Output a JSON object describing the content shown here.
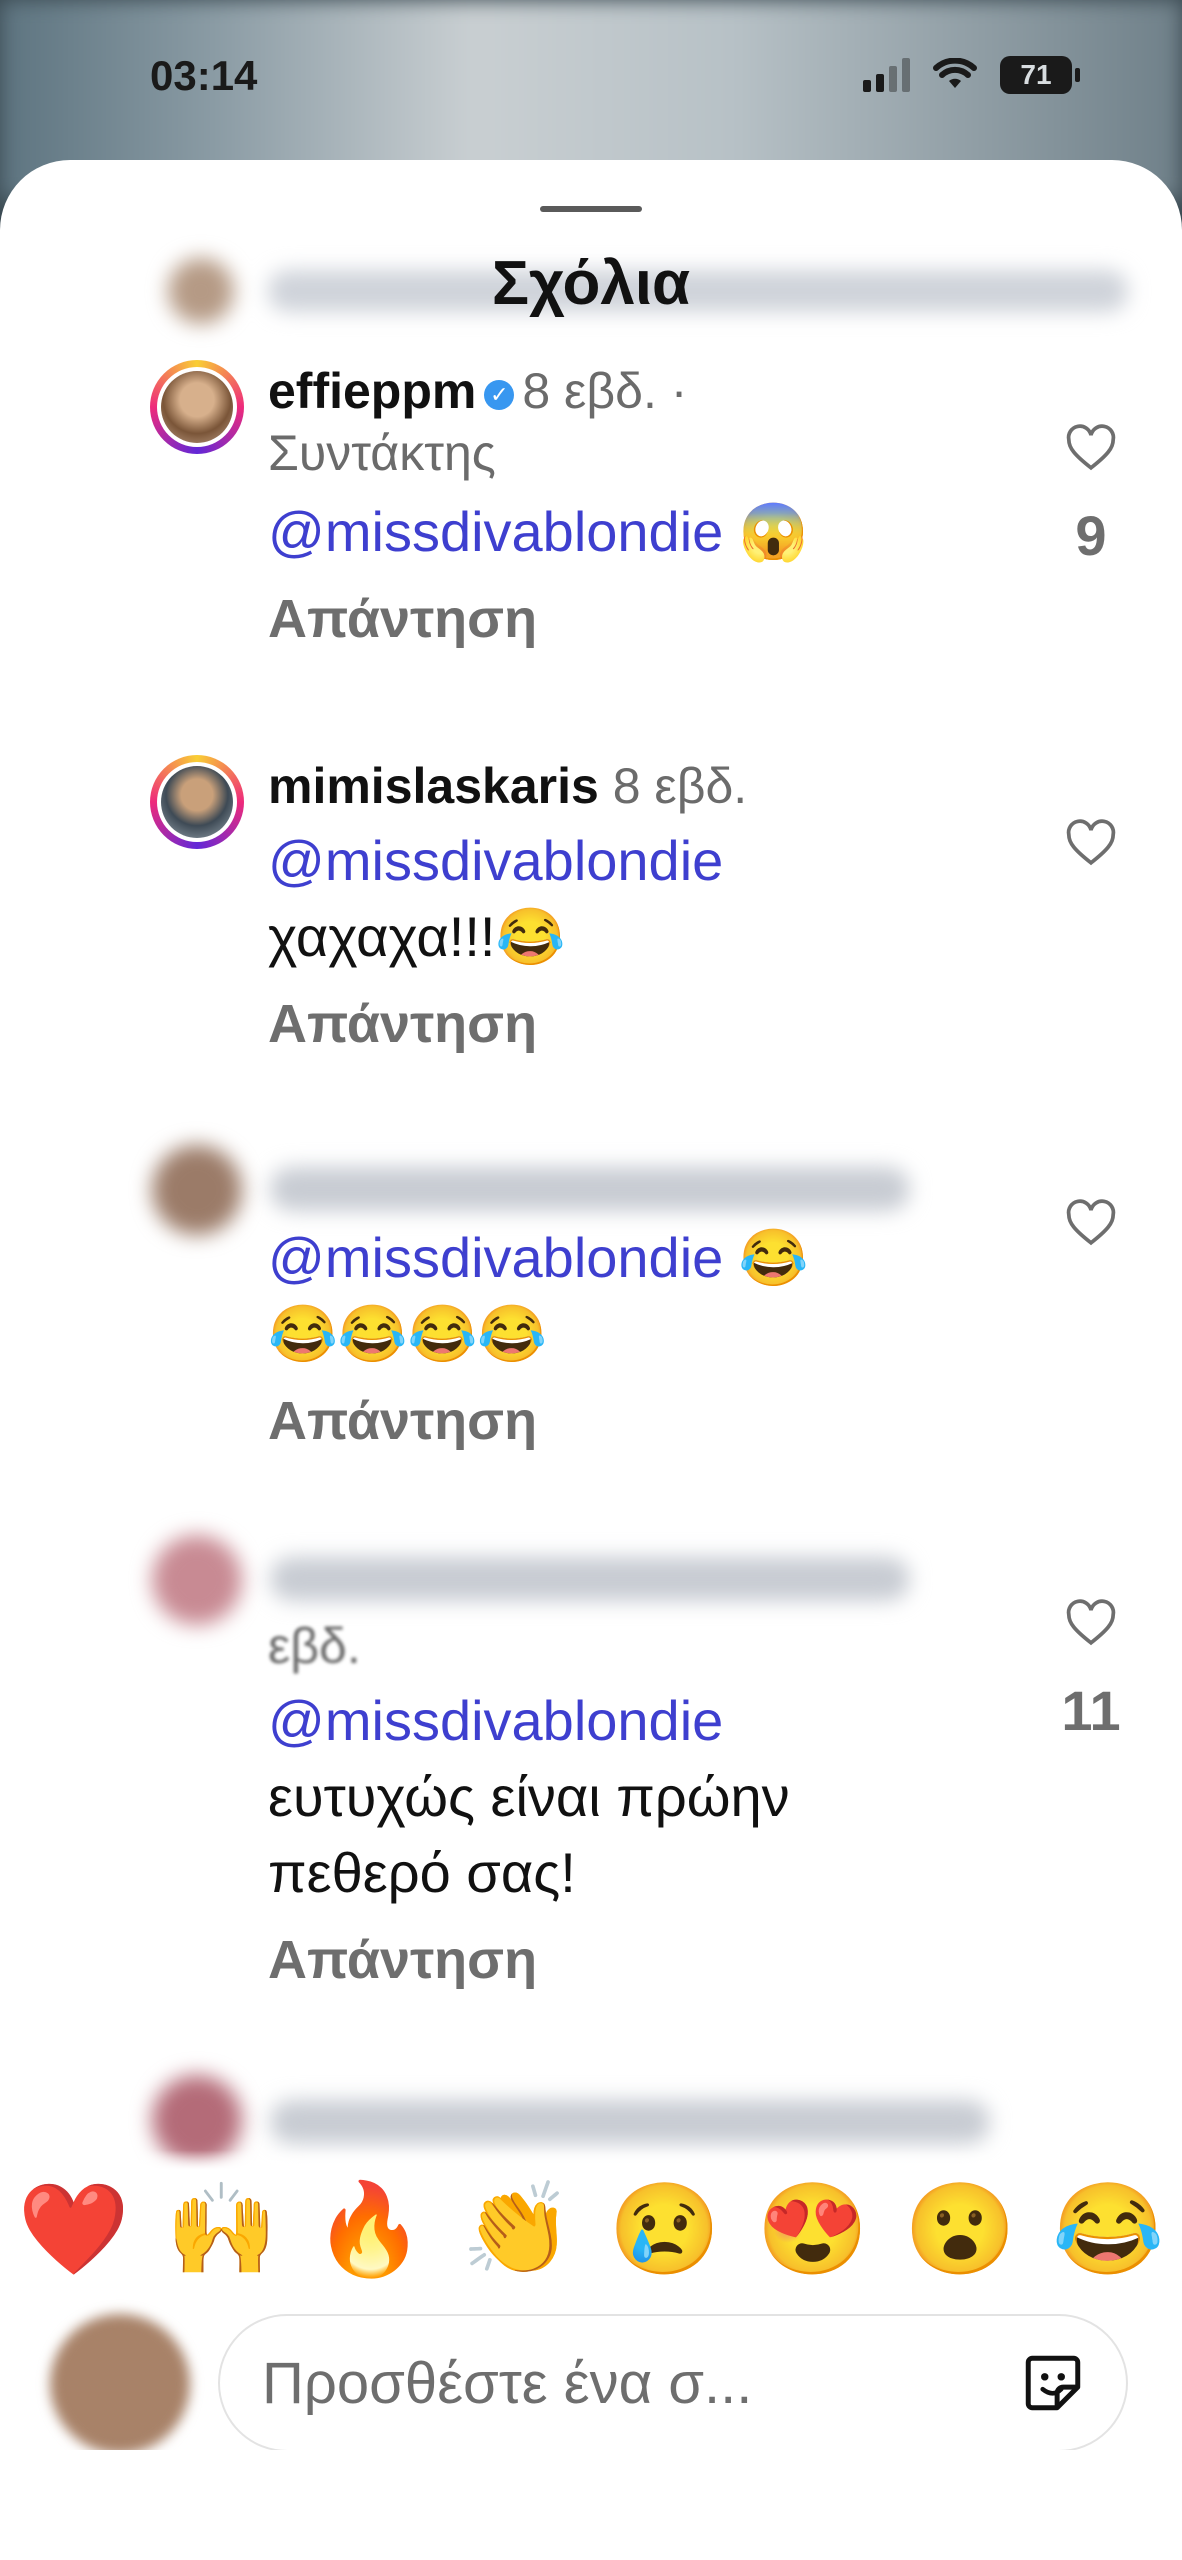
{
  "status": {
    "time": "03:14",
    "battery": "71"
  },
  "sheet": {
    "title": "Σχόλια"
  },
  "comments": [
    {
      "username": "effieppm",
      "verified": true,
      "time": "8 εβδ.",
      "separator": "·",
      "role": "Συντάκτης",
      "mention": "@missdivablondie",
      "text": "😱",
      "reply": "Απάντηση",
      "likes": "9"
    },
    {
      "username": "mimislaskaris",
      "time": "8 εβδ.",
      "mention": "@missdivablondie",
      "text": "χαχαχα!!!😂",
      "reply": "Απάντηση",
      "likes": ""
    },
    {
      "mention": "@missdivablondie",
      "text_line1": "😂",
      "text_line2": "😂😂😂😂",
      "reply": "Απάντηση",
      "likes": ""
    },
    {
      "meta_partial": "εβδ.",
      "mention": "@missdivablondie",
      "text_line1": "ευτυχώς είναι πρώην",
      "text_line2": "πεθερό σας!",
      "reply": "Απάντηση",
      "likes": "11"
    }
  ],
  "quick_reactions": [
    "❤️",
    "🙌",
    "🔥",
    "👏",
    "😢",
    "😍",
    "😮",
    "😂"
  ],
  "composer": {
    "placeholder": "Προσθέστε ένα σ..."
  },
  "icons": {
    "like": "heart-icon",
    "sticker": "sticker-icon",
    "wifi": "wifi-icon",
    "signal": "signal-icon",
    "battery": "battery-icon"
  }
}
